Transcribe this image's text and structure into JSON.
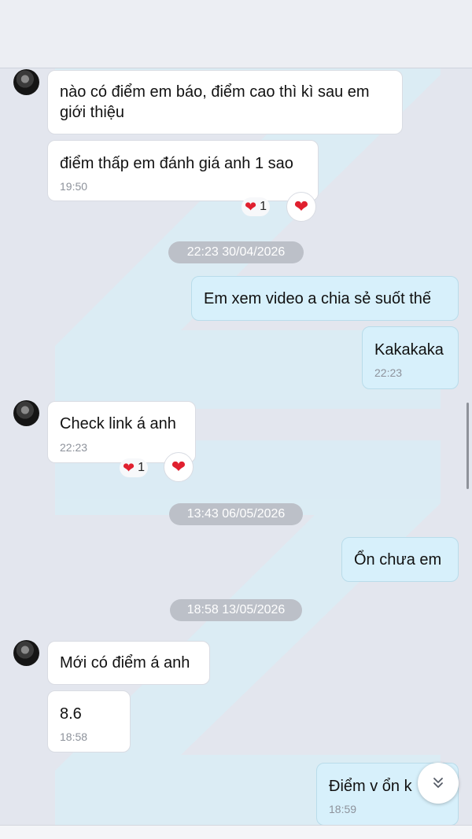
{
  "messages": [
    {
      "direction": "incoming",
      "text": "nào có điểm em báo, điểm cao thì kì sau em giới thiệu"
    },
    {
      "direction": "incoming",
      "text": "điểm thấp em đánh giá anh 1 sao",
      "time": "19:50",
      "reaction": {
        "emoji": "❤",
        "count": "1"
      }
    },
    {
      "direction": "outgoing",
      "text": "Em xem video a chia sẻ suốt thế"
    },
    {
      "direction": "outgoing",
      "text": "Kakakaka",
      "time": "22:23"
    },
    {
      "direction": "incoming",
      "text": "Check link á anh",
      "time": "22:23",
      "reaction": {
        "emoji": "❤",
        "count": "1"
      }
    },
    {
      "direction": "outgoing",
      "text": "Ổn chưa em"
    },
    {
      "direction": "incoming",
      "text": "Mới có điểm á anh"
    },
    {
      "direction": "incoming",
      "text": "8.6",
      "time": "18:58"
    },
    {
      "direction": "outgoing",
      "text": "Điểm v ổn k",
      "time": "18:59"
    }
  ],
  "date_separators": [
    "22:23 30/04/2026",
    "13:43 06/05/2026",
    "18:58 13/05/2026"
  ],
  "icons": {
    "heart": "❤",
    "scroll_down": "chevron-double-down-icon"
  },
  "colors": {
    "background": "#e3e6ee",
    "incoming_bubble": "#ffffff",
    "outgoing_bubble": "#d7f0fb",
    "heart": "#e0202f",
    "date_chip": "#bcc0c8"
  }
}
